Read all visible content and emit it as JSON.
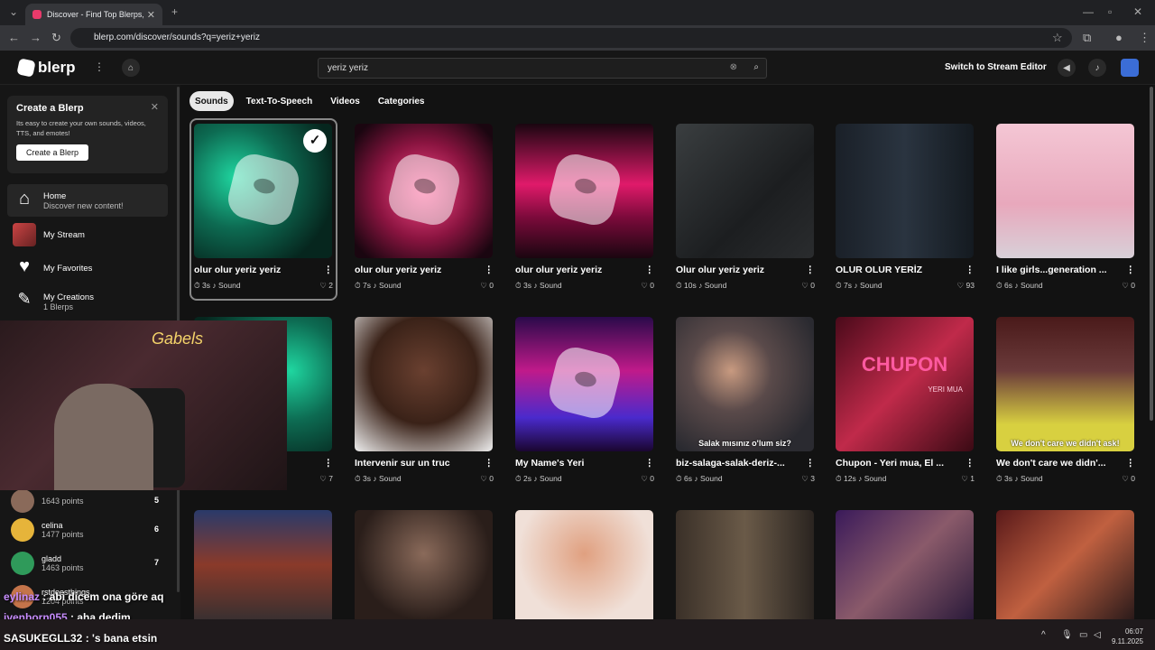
{
  "browser": {
    "tab_title": "Discover - Find Top Blerps, Stre",
    "url": "blerp.com/discover/sounds?q=yeriz+yeriz"
  },
  "nav": {
    "logo": "blerp",
    "search": "yeriz yeriz",
    "stream_editor": "Switch to Stream Editor"
  },
  "create_card": {
    "title": "Create a Blerp",
    "desc": "Its easy to create your own sounds, videos, TTS, and emotes!",
    "button": "Create a Blerp"
  },
  "sidebar": [
    {
      "label": "Home",
      "sub": "Discover new content!"
    },
    {
      "label": "My Stream",
      "sub": ""
    },
    {
      "label": "My Favorites",
      "sub": ""
    },
    {
      "label": "My Creations",
      "sub": "1 Blerps"
    }
  ],
  "leaderboard": [
    {
      "name": "",
      "points": "1643 points",
      "rank": "5"
    },
    {
      "name": "celina",
      "points": "1477 points",
      "rank": "6"
    },
    {
      "name": "gladd",
      "points": "1463 points",
      "rank": "7"
    },
    {
      "name": "rstdoesthings",
      "points": "1204 points",
      "rank": ""
    }
  ],
  "chips": [
    "Sounds",
    "Text-To-Speech",
    "Videos",
    "Categories"
  ],
  "row1": [
    {
      "title": "olur olur yeriz yeriz",
      "dur": "3s",
      "type": "Sound",
      "likes": "2"
    },
    {
      "title": "olur olur yeriz yeriz",
      "dur": "7s",
      "type": "Sound",
      "likes": "0"
    },
    {
      "title": "olur olur yeriz yeriz",
      "dur": "3s",
      "type": "Sound",
      "likes": "0"
    },
    {
      "title": "Olur olur yeriz yeriz",
      "dur": "10s",
      "type": "Sound",
      "likes": "0"
    },
    {
      "title": "OLUR OLUR YERİZ",
      "dur": "7s",
      "type": "Sound",
      "likes": "93"
    },
    {
      "title": "I like girls...generation ...",
      "dur": "6s",
      "type": "Sound",
      "likes": "0"
    }
  ],
  "row2": [
    {
      "title": "",
      "dur": "",
      "type": "",
      "likes": "7"
    },
    {
      "title": "Intervenir sur un truc",
      "dur": "3s",
      "type": "Sound",
      "likes": "0"
    },
    {
      "title": "My Name's Yeri",
      "dur": "2s",
      "type": "Sound",
      "likes": "0"
    },
    {
      "title": "biz-salaga-salak-deriz-...",
      "dur": "6s",
      "type": "Sound",
      "likes": "3"
    },
    {
      "title": "Chupon - Yeri mua, El ...",
      "dur": "12s",
      "type": "Sound",
      "likes": "1"
    },
    {
      "title": "We don't care we didn'...",
      "dur": "3s",
      "type": "Sound",
      "likes": "0"
    }
  ],
  "captions": {
    "c1": "Salak mısınız o'lum siz?",
    "c2": "We don't care we didn't ask!",
    "c3": "CHUPON",
    "c4": "YERI MUA",
    "neon": "Gabels"
  },
  "chat": [
    {
      "user": "eylinaz",
      "msg": ": abi dicem ona göre aq"
    },
    {
      "user": "ivenborn055",
      "msg": ": aha dedim"
    },
    {
      "user": "SASUKEGLL32",
      "msg": ": 's bana etsin"
    }
  ],
  "clock": {
    "time": "06:07",
    "date": "9.11.2025"
  },
  "colors": {
    "accent": "#e83a6b",
    "bg": "#121212"
  }
}
